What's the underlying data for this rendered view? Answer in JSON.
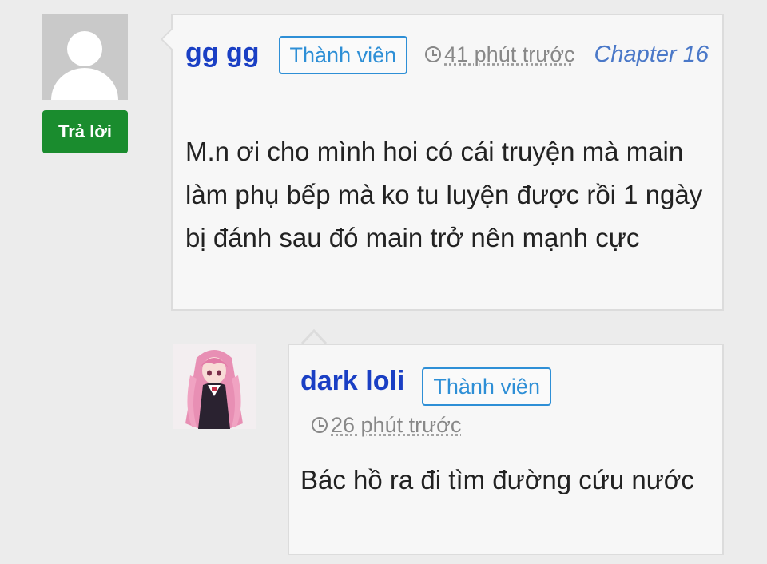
{
  "comments": [
    {
      "username": "gg gg",
      "role": "Thành viên",
      "time": "41 phút trước",
      "chapter": "Chapter 16",
      "text": "M.n ơi cho mình hoi có cái truyện mà main làm phụ bếp mà ko tu luyện được rồi 1 ngày bị đánh sau đó main trở nên mạnh cực",
      "reply_label": "Trả lời",
      "avatar": "default-user-avatar"
    }
  ],
  "replies": [
    {
      "username": "dark loli",
      "role": "Thành viên",
      "time": "26 phút trước",
      "text": "Bác hồ ra đi tìm đường cứu nước",
      "avatar": "anime-girl-avatar"
    }
  ],
  "colors": {
    "background": "#ececec",
    "username": "#1a3fc4",
    "badge": "#2e8fd6",
    "reply_button": "#1a8c2e",
    "chapter_link": "#4a78c8",
    "time": "#888888"
  }
}
